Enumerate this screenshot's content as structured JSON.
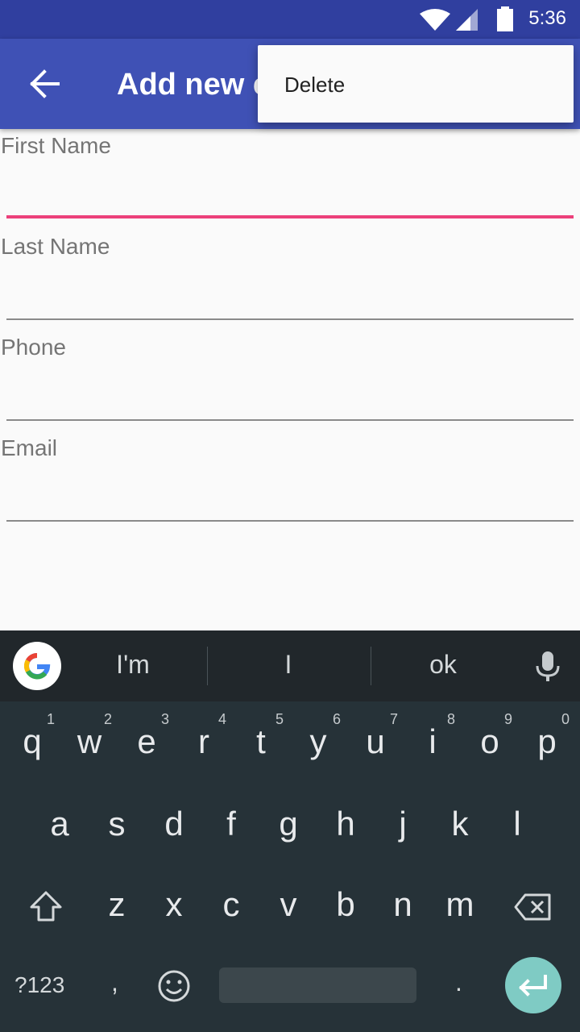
{
  "status_bar": {
    "time": "5:36",
    "icons": [
      "wifi-icon",
      "signal-icon",
      "battery-icon"
    ]
  },
  "app_bar": {
    "title": "Add new contact",
    "back_icon": "arrow-back-icon",
    "color": "#3f51b5"
  },
  "overflow_menu": {
    "items": [
      {
        "label": "Delete"
      }
    ]
  },
  "form": {
    "fields": [
      {
        "label": "First Name",
        "value": "",
        "active": true
      },
      {
        "label": "Last Name",
        "value": ""
      },
      {
        "label": "Phone",
        "value": ""
      },
      {
        "label": "Email",
        "value": ""
      }
    ],
    "accent_color": "#ec407a"
  },
  "keyboard": {
    "suggestions": [
      "I'm",
      "I",
      "ok"
    ],
    "row1": [
      {
        "key": "q",
        "hint": "1"
      },
      {
        "key": "w",
        "hint": "2"
      },
      {
        "key": "e",
        "hint": "3"
      },
      {
        "key": "r",
        "hint": "4"
      },
      {
        "key": "t",
        "hint": "5"
      },
      {
        "key": "y",
        "hint": "6"
      },
      {
        "key": "u",
        "hint": "7"
      },
      {
        "key": "i",
        "hint": "8"
      },
      {
        "key": "o",
        "hint": "9"
      },
      {
        "key": "p",
        "hint": "0"
      }
    ],
    "row2": [
      "a",
      "s",
      "d",
      "f",
      "g",
      "h",
      "j",
      "k",
      "l"
    ],
    "row3": [
      "z",
      "x",
      "c",
      "v",
      "b",
      "n",
      "m"
    ],
    "symbols_label": "?123",
    "comma": ",",
    "period": ".",
    "enter_color": "#7fcbc4"
  }
}
